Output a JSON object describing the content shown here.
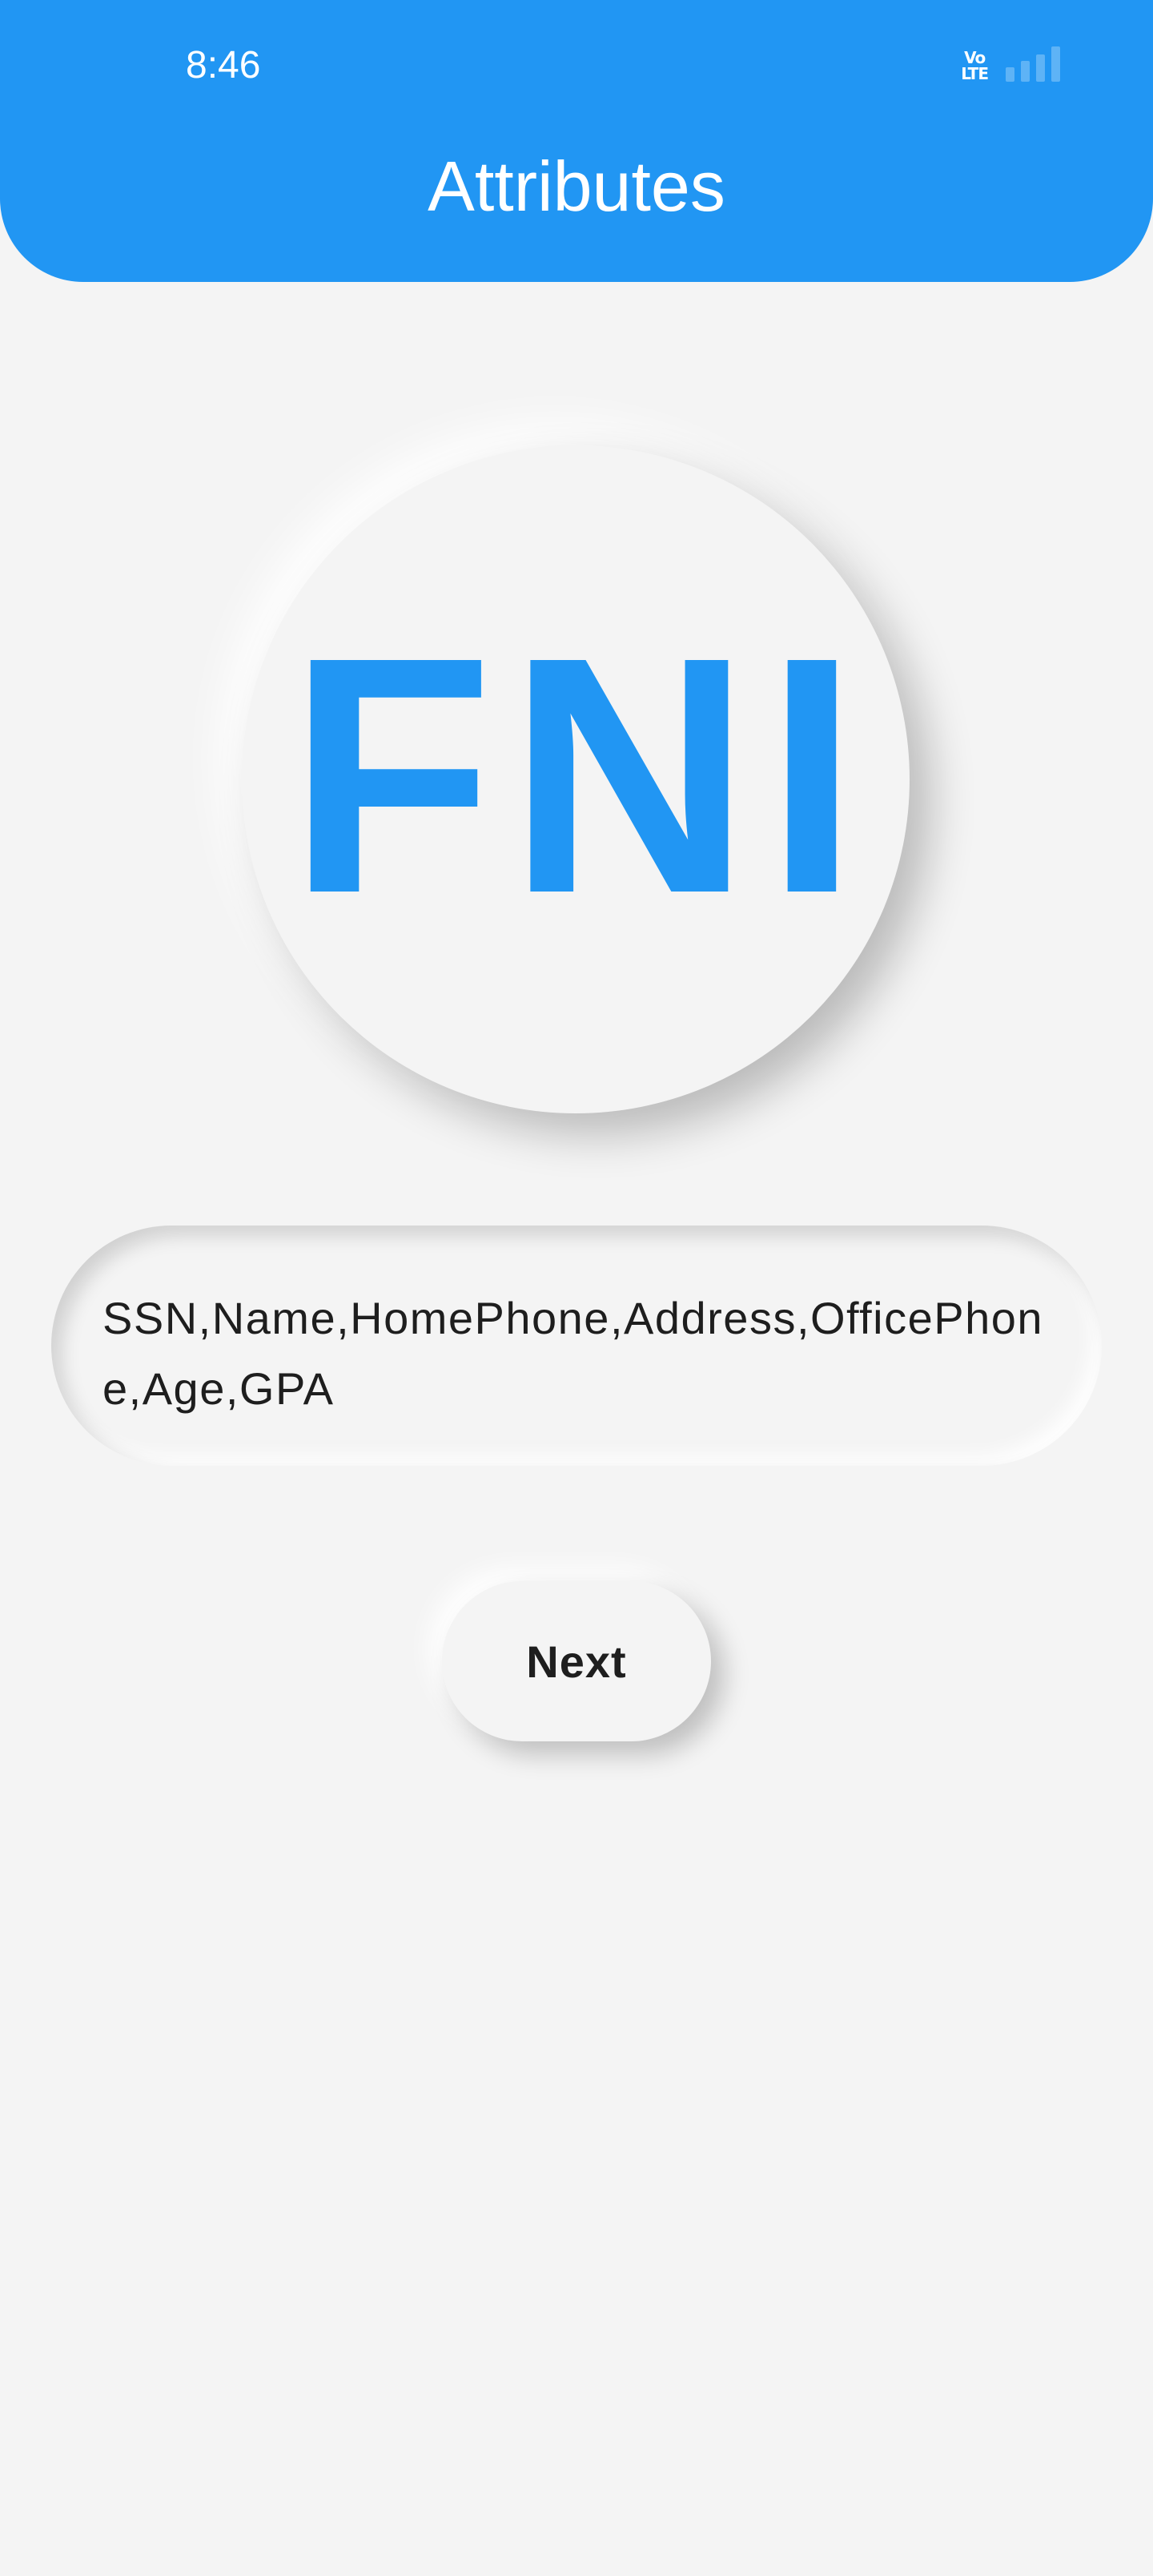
{
  "status_bar": {
    "time": "8:46",
    "network_line1": "Vo",
    "network_line2": "LTE",
    "signal_icon": "signal-bars-icon"
  },
  "app_bar": {
    "title": "Attributes"
  },
  "logo": {
    "text": "FNI"
  },
  "attributes": {
    "value": "SSN,Name,HomePhone,Address,OfficePhone,Age,GPA"
  },
  "actions": {
    "next_label": "Next"
  },
  "colors": {
    "primary": "#2196f3",
    "background": "#f4f4f4",
    "text": "#1e1e1e"
  }
}
